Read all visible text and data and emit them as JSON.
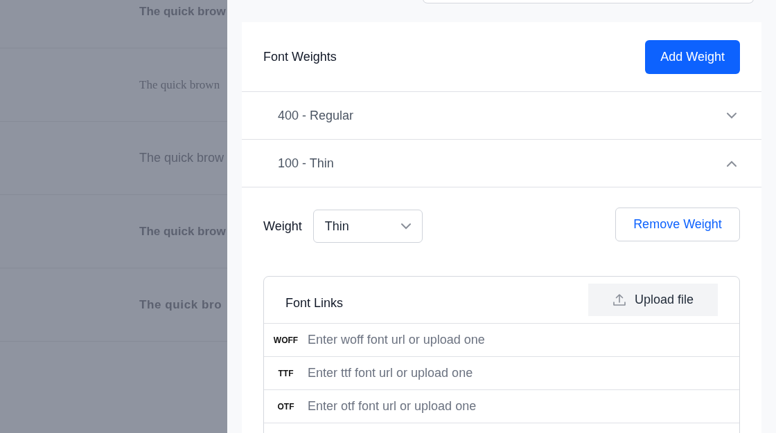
{
  "samples": [
    {
      "text": "The quick brow",
      "kind": "bold"
    },
    {
      "text": "The quick brown",
      "kind": "serif"
    },
    {
      "text": "The quick brow",
      "kind": "regular"
    },
    {
      "text": "The quick brow",
      "kind": "bold"
    },
    {
      "text": "The quick bro",
      "kind": "black"
    }
  ],
  "font_weights": {
    "title": "Font Weights",
    "add_button": "Add Weight",
    "items": [
      {
        "label": "400 - Regular",
        "expanded": false
      },
      {
        "label": "100 - Thin",
        "expanded": true
      }
    ]
  },
  "weight_editor": {
    "label": "Weight",
    "select_value": "Thin",
    "remove_button": "Remove Weight",
    "links": {
      "title": "Font Links",
      "upload_button": "Upload file",
      "rows": [
        {
          "format": "WOFF",
          "placeholder": "Enter woff font url or upload one"
        },
        {
          "format": "TTF",
          "placeholder": "Enter ttf font url or upload one"
        },
        {
          "format": "OTF",
          "placeholder": "Enter otf font url or upload one"
        }
      ]
    }
  }
}
